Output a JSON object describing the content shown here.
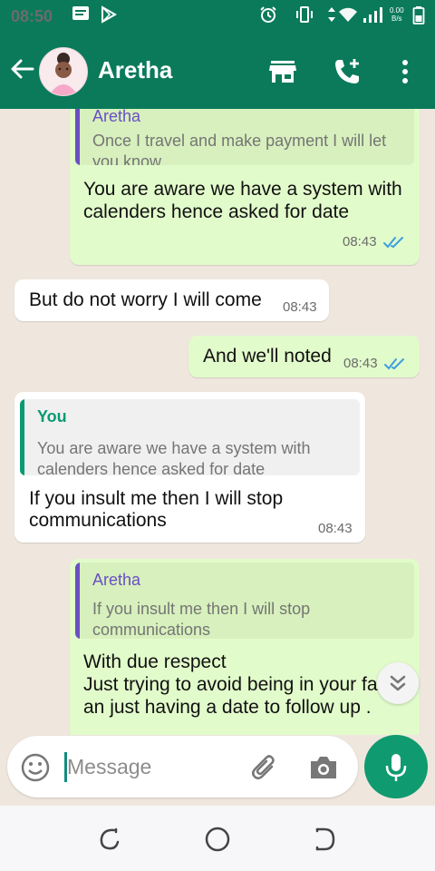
{
  "status_bar": {
    "time": "08:50",
    "net_rate_value": "0.00",
    "net_rate_unit": "B/s",
    "icons": [
      "message-notification-icon",
      "play-store-icon",
      "alarm-icon",
      "vibrate-icon",
      "wifi-icon",
      "signal-icon",
      "battery-icon"
    ]
  },
  "header": {
    "contact_name": "Aretha",
    "icons": [
      "back-arrow-icon",
      "avatar",
      "shop-icon",
      "add-call-icon",
      "more-vert-icon"
    ]
  },
  "messages": [
    {
      "direction": "outgoing",
      "quote_author": "Aretha",
      "quote_lines": [
        "Once I travel and make payment I will let",
        "you know"
      ],
      "text_lines": [
        "You are aware we have a system with",
        "calenders hence asked for date"
      ],
      "time": "08:43",
      "read": true
    },
    {
      "direction": "incoming",
      "text_lines": [
        "But do not worry I will come"
      ],
      "time": "08:43"
    },
    {
      "direction": "outgoing",
      "text_lines": [
        "And we'll noted"
      ],
      "time": "08:43",
      "read": true
    },
    {
      "direction": "incoming",
      "quote_author": "You",
      "quote_lines": [
        "You are aware we have a system with",
        "calenders hence asked for date"
      ],
      "text_lines": [
        "If you insult me then I will stop",
        "communications"
      ],
      "time": "08:43"
    },
    {
      "direction": "outgoing",
      "quote_author": "Aretha",
      "quote_lines": [
        "If you insult me then I will stop",
        "communications"
      ],
      "text_lines": [
        "With due respect",
        "Just trying to avoid being in your fac",
        "an just having a date to follow up ."
      ]
    }
  ],
  "composer": {
    "placeholder": "Message",
    "icons": [
      "emoji-icon",
      "attach-icon",
      "camera-icon",
      "mic-icon"
    ]
  },
  "nav_bar": {
    "icons": [
      "recent-apps-icon",
      "home-icon",
      "back-icon"
    ]
  },
  "colors": {
    "header_green": "#0a7a5a",
    "outgoing_bubble": "#e2fbcb",
    "incoming_bubble": "#ffffff",
    "quote_aretha": "#6a4fc4",
    "quote_you": "#0a9a73",
    "read_ticks": "#3b9fe0",
    "mic_button": "#109a6f"
  }
}
